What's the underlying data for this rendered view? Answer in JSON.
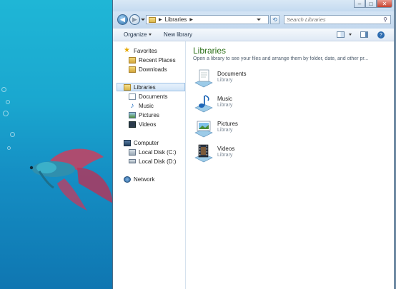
{
  "address": {
    "location": "Libraries",
    "separator": "▶"
  },
  "search": {
    "placeholder": "Search Libraries"
  },
  "toolbar": {
    "organize": "Organize",
    "new_library": "New library"
  },
  "nav": {
    "favorites": {
      "label": "Favorites",
      "items": [
        {
          "label": "Recent Places"
        },
        {
          "label": "Downloads"
        }
      ]
    },
    "libraries": {
      "label": "Libraries",
      "items": [
        {
          "label": "Documents"
        },
        {
          "label": "Music"
        },
        {
          "label": "Pictures"
        },
        {
          "label": "Videos"
        }
      ]
    },
    "computer": {
      "label": "Computer",
      "items": [
        {
          "label": "Local Disk (C:)"
        },
        {
          "label": "Local Disk (D:)"
        }
      ]
    },
    "network": {
      "label": "Network"
    }
  },
  "content": {
    "title": "Libraries",
    "subtitle": "Open a library to see your files and arrange them by folder, date, and other pr...",
    "libraries": [
      {
        "name": "Documents",
        "type": "Library"
      },
      {
        "name": "Music",
        "type": "Library"
      },
      {
        "name": "Pictures",
        "type": "Library"
      },
      {
        "name": "Videos",
        "type": "Library"
      }
    ]
  },
  "colors": {
    "title_green": "#2b6f17",
    "selection": "#cfe3f7",
    "desktop": "#1aa7cf"
  }
}
